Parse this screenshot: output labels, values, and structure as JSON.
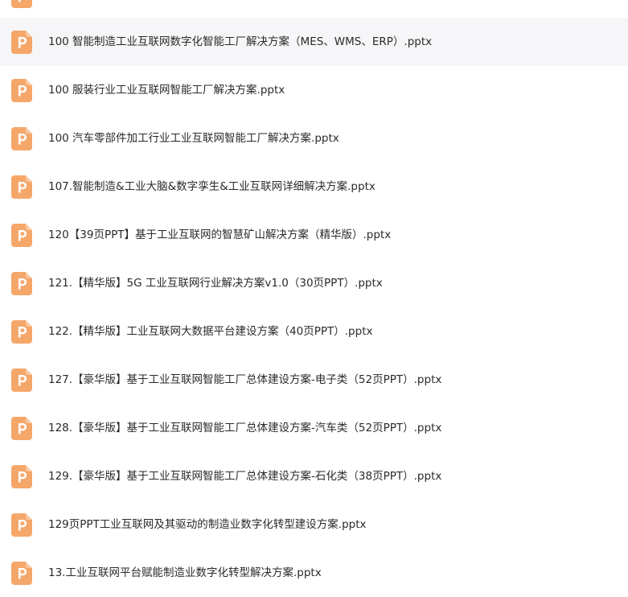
{
  "icon_colors": {
    "fill": "#f5a76a",
    "fold": "#f8c9a2",
    "letter": "#ffffff"
  },
  "file_icon_letter": "P",
  "selected_index": 0,
  "files": [
    {
      "name": "100 智能制造工业互联网数字化智能工厂解决方案（MES、WMS、ERP）.pptx"
    },
    {
      "name": "100 服装行业工业互联网智能工厂解决方案.pptx"
    },
    {
      "name": "100 汽车零部件加工行业工业互联网智能工厂解决方案.pptx"
    },
    {
      "name": "107.智能制造&工业大脑&数字孪生&工业互联网详细解决方案.pptx"
    },
    {
      "name": "120【39页PPT】基于工业互联网的智慧矿山解决方案（精华版）.pptx"
    },
    {
      "name": "121.【精华版】5G 工业互联网行业解决方案v1.0（30页PPT）.pptx"
    },
    {
      "name": "122.【精华版】工业互联网大数据平台建设方案（40页PPT）.pptx"
    },
    {
      "name": "127.【豪华版】基于工业互联网智能工厂总体建设方案-电子类（52页PPT）.pptx"
    },
    {
      "name": "128.【豪华版】基于工业互联网智能工厂总体建设方案-汽车类（52页PPT）.pptx"
    },
    {
      "name": "129.【豪华版】基于工业互联网智能工厂总体建设方案-石化类（38页PPT）.pptx"
    },
    {
      "name": "129页PPT工业互联网及其驱动的制造业数字化转型建设方案.pptx"
    },
    {
      "name": "13.工业互联网平台赋能制造业数字化转型解决方案.pptx"
    }
  ]
}
